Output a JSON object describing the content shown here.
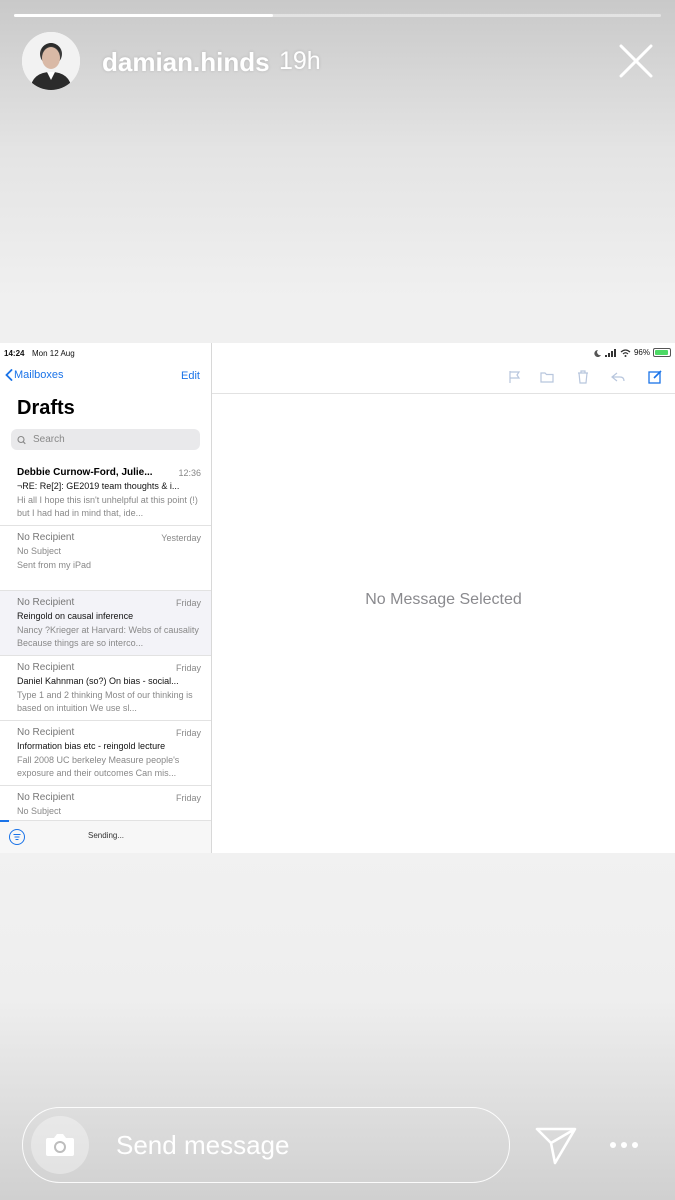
{
  "story": {
    "username": "damian.hinds",
    "time_ago": "19h",
    "progress": 0.4
  },
  "ipad": {
    "status": {
      "time": "14:24",
      "date": "Mon 12 Aug",
      "battery": "96%"
    },
    "nav": {
      "back_label": "Mailboxes",
      "edit_label": "Edit"
    },
    "title": "Drafts",
    "search": {
      "placeholder": "Search"
    },
    "mails": [
      {
        "sender": "Debbie Curnow-Ford, Julie...",
        "date": "12:36",
        "subject": "¬RE: Re[2]: GE2019 team thoughts & i...",
        "preview": "Hi all I hope this isn't unhelpful at this point (!) but I had had in mind that, ide..."
      },
      {
        "sender": "No Recipient",
        "date": "Yesterday",
        "subject": "No Subject",
        "preview": "Sent from my iPad"
      },
      {
        "sender": "No Recipient",
        "date": "Friday",
        "subject": "Reingold on causal inference",
        "preview": "Nancy ?Krieger at Harvard: Webs of causality Because things are so interco..."
      },
      {
        "sender": "No Recipient",
        "date": "Friday",
        "subject": "Daniel Kahnman (so?) On bias - social...",
        "preview": "Type 1 and 2 thinking Most of our thinking is based on intuition We use sl..."
      },
      {
        "sender": "No Recipient",
        "date": "Friday",
        "subject": "Information bias etc - reingold lecture",
        "preview": "Fall 2008 UC berkeley Measure people's exposure and their outcomes Can mis..."
      },
      {
        "sender": "No Recipient",
        "date": "Friday",
        "subject": "No Subject",
        "preview": ""
      }
    ],
    "bottom_status": "Sending...",
    "empty_state": "No Message Selected"
  },
  "message_bar": {
    "placeholder": "Send message"
  }
}
